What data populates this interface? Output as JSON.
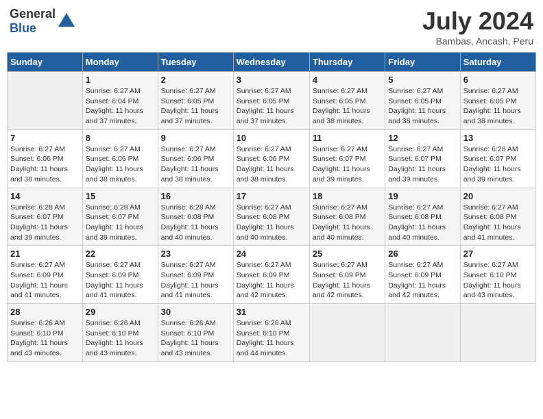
{
  "header": {
    "logo_general": "General",
    "logo_blue": "Blue",
    "month_year": "July 2024",
    "location": "Bambas, Ancash, Peru"
  },
  "weekdays": [
    "Sunday",
    "Monday",
    "Tuesday",
    "Wednesday",
    "Thursday",
    "Friday",
    "Saturday"
  ],
  "weeks": [
    [
      {
        "day": "",
        "sunrise": "",
        "sunset": "",
        "daylight": ""
      },
      {
        "day": "1",
        "sunrise": "Sunrise: 6:27 AM",
        "sunset": "Sunset: 6:04 PM",
        "daylight": "Daylight: 11 hours and 37 minutes."
      },
      {
        "day": "2",
        "sunrise": "Sunrise: 6:27 AM",
        "sunset": "Sunset: 6:05 PM",
        "daylight": "Daylight: 11 hours and 37 minutes."
      },
      {
        "day": "3",
        "sunrise": "Sunrise: 6:27 AM",
        "sunset": "Sunset: 6:05 PM",
        "daylight": "Daylight: 11 hours and 37 minutes."
      },
      {
        "day": "4",
        "sunrise": "Sunrise: 6:27 AM",
        "sunset": "Sunset: 6:05 PM",
        "daylight": "Daylight: 11 hours and 38 minutes."
      },
      {
        "day": "5",
        "sunrise": "Sunrise: 6:27 AM",
        "sunset": "Sunset: 6:05 PM",
        "daylight": "Daylight: 11 hours and 38 minutes."
      },
      {
        "day": "6",
        "sunrise": "Sunrise: 6:27 AM",
        "sunset": "Sunset: 6:05 PM",
        "daylight": "Daylight: 11 hours and 38 minutes."
      }
    ],
    [
      {
        "day": "7",
        "sunrise": "Sunrise: 6:27 AM",
        "sunset": "Sunset: 6:06 PM",
        "daylight": "Daylight: 11 hours and 38 minutes."
      },
      {
        "day": "8",
        "sunrise": "Sunrise: 6:27 AM",
        "sunset": "Sunset: 6:06 PM",
        "daylight": "Daylight: 11 hours and 38 minutes."
      },
      {
        "day": "9",
        "sunrise": "Sunrise: 6:27 AM",
        "sunset": "Sunset: 6:06 PM",
        "daylight": "Daylight: 11 hours and 38 minutes."
      },
      {
        "day": "10",
        "sunrise": "Sunrise: 6:27 AM",
        "sunset": "Sunset: 6:06 PM",
        "daylight": "Daylight: 11 hours and 38 minutes."
      },
      {
        "day": "11",
        "sunrise": "Sunrise: 6:27 AM",
        "sunset": "Sunset: 6:07 PM",
        "daylight": "Daylight: 11 hours and 39 minutes."
      },
      {
        "day": "12",
        "sunrise": "Sunrise: 6:27 AM",
        "sunset": "Sunset: 6:07 PM",
        "daylight": "Daylight: 11 hours and 39 minutes."
      },
      {
        "day": "13",
        "sunrise": "Sunrise: 6:28 AM",
        "sunset": "Sunset: 6:07 PM",
        "daylight": "Daylight: 11 hours and 39 minutes."
      }
    ],
    [
      {
        "day": "14",
        "sunrise": "Sunrise: 6:28 AM",
        "sunset": "Sunset: 6:07 PM",
        "daylight": "Daylight: 11 hours and 39 minutes."
      },
      {
        "day": "15",
        "sunrise": "Sunrise: 6:28 AM",
        "sunset": "Sunset: 6:07 PM",
        "daylight": "Daylight: 11 hours and 39 minutes."
      },
      {
        "day": "16",
        "sunrise": "Sunrise: 6:28 AM",
        "sunset": "Sunset: 6:08 PM",
        "daylight": "Daylight: 11 hours and 40 minutes."
      },
      {
        "day": "17",
        "sunrise": "Sunrise: 6:27 AM",
        "sunset": "Sunset: 6:08 PM",
        "daylight": "Daylight: 11 hours and 40 minutes."
      },
      {
        "day": "18",
        "sunrise": "Sunrise: 6:27 AM",
        "sunset": "Sunset: 6:08 PM",
        "daylight": "Daylight: 11 hours and 40 minutes."
      },
      {
        "day": "19",
        "sunrise": "Sunrise: 6:27 AM",
        "sunset": "Sunset: 6:08 PM",
        "daylight": "Daylight: 11 hours and 40 minutes."
      },
      {
        "day": "20",
        "sunrise": "Sunrise: 6:27 AM",
        "sunset": "Sunset: 6:08 PM",
        "daylight": "Daylight: 11 hours and 41 minutes."
      }
    ],
    [
      {
        "day": "21",
        "sunrise": "Sunrise: 6:27 AM",
        "sunset": "Sunset: 6:09 PM",
        "daylight": "Daylight: 11 hours and 41 minutes."
      },
      {
        "day": "22",
        "sunrise": "Sunrise: 6:27 AM",
        "sunset": "Sunset: 6:09 PM",
        "daylight": "Daylight: 11 hours and 41 minutes."
      },
      {
        "day": "23",
        "sunrise": "Sunrise: 6:27 AM",
        "sunset": "Sunset: 6:09 PM",
        "daylight": "Daylight: 11 hours and 41 minutes."
      },
      {
        "day": "24",
        "sunrise": "Sunrise: 6:27 AM",
        "sunset": "Sunset: 6:09 PM",
        "daylight": "Daylight: 11 hours and 42 minutes."
      },
      {
        "day": "25",
        "sunrise": "Sunrise: 6:27 AM",
        "sunset": "Sunset: 6:09 PM",
        "daylight": "Daylight: 11 hours and 42 minutes."
      },
      {
        "day": "26",
        "sunrise": "Sunrise: 6:27 AM",
        "sunset": "Sunset: 6:09 PM",
        "daylight": "Daylight: 11 hours and 42 minutes."
      },
      {
        "day": "27",
        "sunrise": "Sunrise: 6:27 AM",
        "sunset": "Sunset: 6:10 PM",
        "daylight": "Daylight: 11 hours and 43 minutes."
      }
    ],
    [
      {
        "day": "28",
        "sunrise": "Sunrise: 6:26 AM",
        "sunset": "Sunset: 6:10 PM",
        "daylight": "Daylight: 11 hours and 43 minutes."
      },
      {
        "day": "29",
        "sunrise": "Sunrise: 6:26 AM",
        "sunset": "Sunset: 6:10 PM",
        "daylight": "Daylight: 11 hours and 43 minutes."
      },
      {
        "day": "30",
        "sunrise": "Sunrise: 6:26 AM",
        "sunset": "Sunset: 6:10 PM",
        "daylight": "Daylight: 11 hours and 43 minutes."
      },
      {
        "day": "31",
        "sunrise": "Sunrise: 6:26 AM",
        "sunset": "Sunset: 6:10 PM",
        "daylight": "Daylight: 11 hours and 44 minutes."
      },
      {
        "day": "",
        "sunrise": "",
        "sunset": "",
        "daylight": ""
      },
      {
        "day": "",
        "sunrise": "",
        "sunset": "",
        "daylight": ""
      },
      {
        "day": "",
        "sunrise": "",
        "sunset": "",
        "daylight": ""
      }
    ]
  ]
}
